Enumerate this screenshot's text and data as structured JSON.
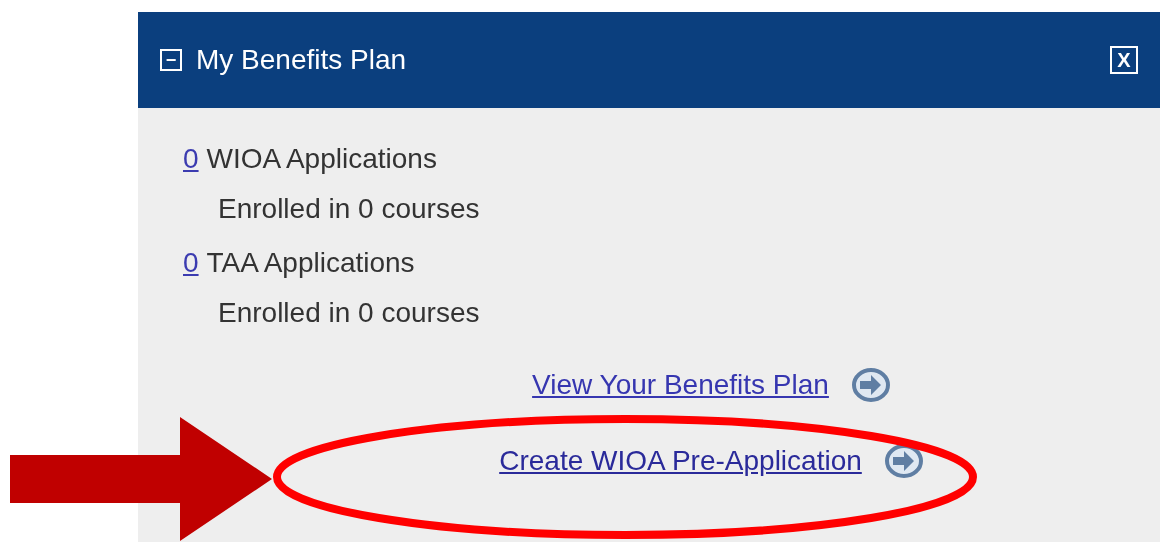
{
  "panel": {
    "title": "My Benefits Plan",
    "collapse_icon": "−",
    "close_icon": "X"
  },
  "summaries": [
    {
      "count": "0",
      "label": "WIOA Applications",
      "detail": "Enrolled in 0 courses"
    },
    {
      "count": "0",
      "label": "TAA Applications",
      "detail": "Enrolled in 0 courses"
    }
  ],
  "links": [
    {
      "label": "View Your Benefits Plan",
      "highlighted": false
    },
    {
      "label": "Create WIOA Pre-Application",
      "highlighted": true
    }
  ]
}
